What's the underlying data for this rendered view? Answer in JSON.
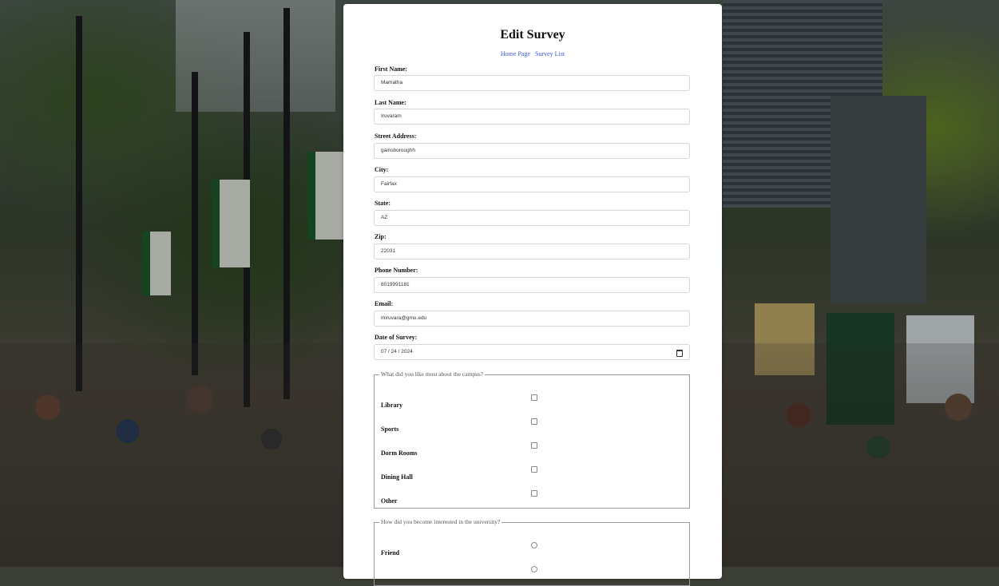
{
  "page": {
    "title": "Edit Survey",
    "nav": {
      "home": "Home Page",
      "survey_list": "Survey List"
    }
  },
  "form": {
    "first_name": {
      "label": "First Name:",
      "value": "Mamatha"
    },
    "last_name": {
      "label": "Last Name:",
      "value": "Iruvaram"
    },
    "street": {
      "label": "Street Address:",
      "value": "gainsboroughh"
    },
    "city": {
      "label": "City:",
      "value": "Fairfax"
    },
    "state": {
      "label": "State:",
      "value": "AZ"
    },
    "zip": {
      "label": "Zip:",
      "value": "22031"
    },
    "phone": {
      "label": "Phone Number:",
      "value": "8019991181"
    },
    "email": {
      "label": "Email:",
      "value": "miruvara@gmu.edu"
    },
    "date": {
      "label": "Date of Survey:",
      "value": "07 / 24 / 2024"
    }
  },
  "liked": {
    "legend": "What did you like most about the campus?",
    "options": [
      "Library",
      "Sports",
      "Dorm Rooms",
      "Dining Hall",
      "Other"
    ]
  },
  "interest": {
    "legend": "How did you become interested in the university?",
    "options": [
      "Friend"
    ]
  },
  "colors": {
    "link": "#3b5bdb",
    "card": "#ffffff",
    "border": "#d5d5d5"
  },
  "icons": {
    "date": "calendar-icon"
  }
}
